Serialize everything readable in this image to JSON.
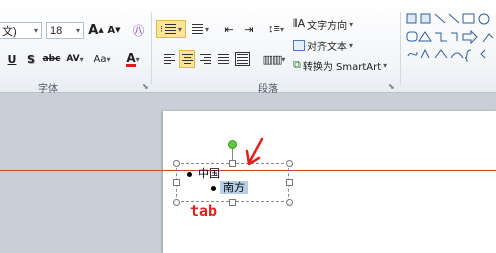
{
  "font": {
    "name_fragment": "文)",
    "size": "18",
    "grow_label": "A",
    "shrink_label": "A",
    "clear_label": "㊇",
    "underline_label": "U",
    "shadow_label": "S",
    "strike_label": "abc",
    "spacing_label": "AV",
    "case_label": "Aa",
    "color_label": "A",
    "group_label": "字体"
  },
  "paragraph": {
    "text_direction_label": "文字方向",
    "align_text_label": "对齐文本",
    "convert_smartart_label": "转换为 SmartArt",
    "group_label": "段落"
  },
  "slide": {
    "bullet_1": "中国",
    "bullet_2": "南方",
    "annotation": "tab"
  },
  "colors": {
    "guide_line": "#e23b2f",
    "annotation": "#e0201a",
    "selection": "#b6cfe6",
    "active_button": "#fbe59b"
  }
}
